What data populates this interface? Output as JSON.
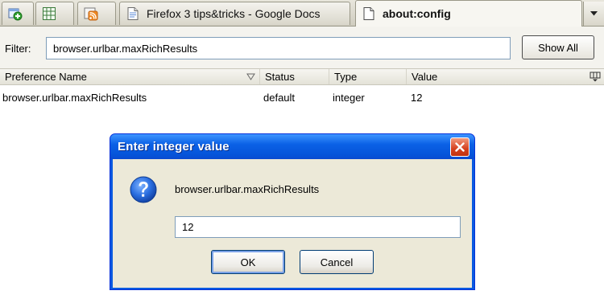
{
  "tabs": [
    {
      "icon": "add-tab-icon",
      "label": ""
    },
    {
      "icon": "spreadsheet-icon",
      "label": ""
    },
    {
      "icon": "rss-feed-icon",
      "label": ""
    },
    {
      "icon": "google-docs-page-icon",
      "label": "Firefox 3 tips&tricks - Google Docs"
    },
    {
      "icon": "blank-page-icon",
      "label": "about:config",
      "active": true
    }
  ],
  "filter": {
    "label": "Filter:",
    "value": "browser.urlbar.maxRichResults",
    "show_all_label": "Show All"
  },
  "table": {
    "columns": [
      "Preference Name",
      "Status",
      "Type",
      "Value"
    ],
    "rows": [
      {
        "name": "browser.urlbar.maxRichResults",
        "status": "default",
        "type": "integer",
        "value": "12"
      }
    ]
  },
  "dialog": {
    "title": "Enter integer value",
    "message": "browser.urlbar.maxRichResults",
    "input_value": "12",
    "ok_label": "OK",
    "cancel_label": "Cancel",
    "icon": "question-icon"
  },
  "colors": {
    "titlebar_blue": "#0a5ae0",
    "close_red": "#d5401f",
    "dialog_body": "#ece9d8"
  }
}
